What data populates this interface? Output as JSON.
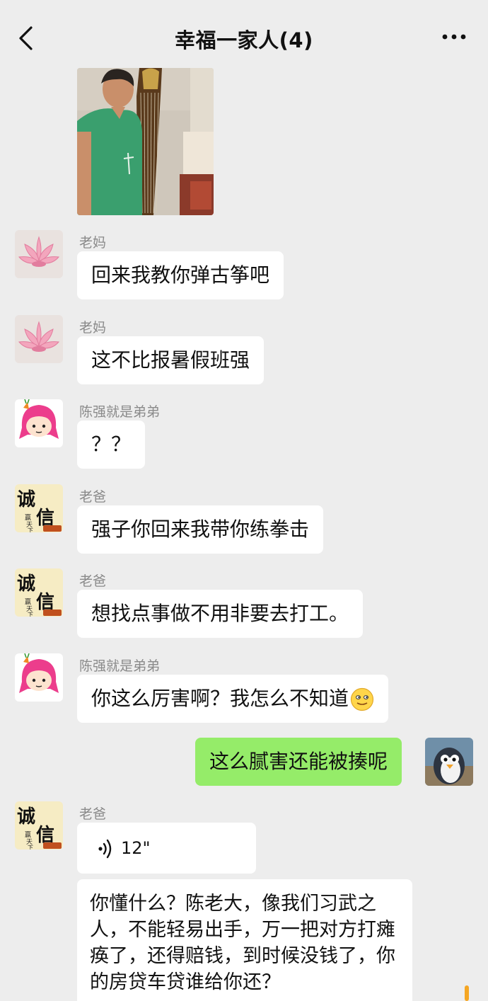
{
  "header": {
    "title": "幸福一家人(4)",
    "back_icon": "chevron-left-icon",
    "more_icon": "ellipsis-icon"
  },
  "messages": [
    {
      "sender": "老妈",
      "text": "回来我教你弹古筝吧",
      "avatar": "lotus-flower-avatar"
    },
    {
      "sender": "老妈",
      "text": "这不比报暑假班强",
      "avatar": "lotus-flower-avatar"
    },
    {
      "sender": "陈强就是弟弟",
      "text": "？？",
      "avatar": "pink-hair-girl-avatar"
    },
    {
      "sender": "老爸",
      "text": "强子你回来我带你练拳击",
      "avatar": "chengxin-calligraphy-avatar"
    },
    {
      "sender": "老爸",
      "text": "想找点事做不用非要去打工。",
      "avatar": "chengxin-calligraphy-avatar"
    },
    {
      "sender": "陈强就是弟弟",
      "text": "你这么厉害啊？我怎么不知道",
      "emoji": "awkward-smile-emoji",
      "avatar": "pink-hair-girl-avatar"
    },
    {
      "sender": "me",
      "text": "这么腻害还能被揍呢",
      "avatar": "penguin-avatar"
    },
    {
      "sender": "老爸",
      "voice_duration": "12\"",
      "avatar": "chengxin-calligraphy-avatar"
    },
    {
      "sender": "老爸",
      "text": "你懂什么？陈老大，像我们习武之人，不能轻易出手，万一把对方打瘫痪了，还得赔钱，到时候没钱了，你的房贷车贷谁给你还？"
    }
  ],
  "avatar_text": {
    "cheng": "诚",
    "xin": "信",
    "ying": "赢",
    "tian": "天",
    "xia": "下"
  },
  "colors": {
    "background": "#ededed",
    "bubble_other": "#ffffff",
    "bubble_me": "#95ec69",
    "sender_name": "#8a8a8a",
    "scroll_indicator": "#f5a623"
  }
}
